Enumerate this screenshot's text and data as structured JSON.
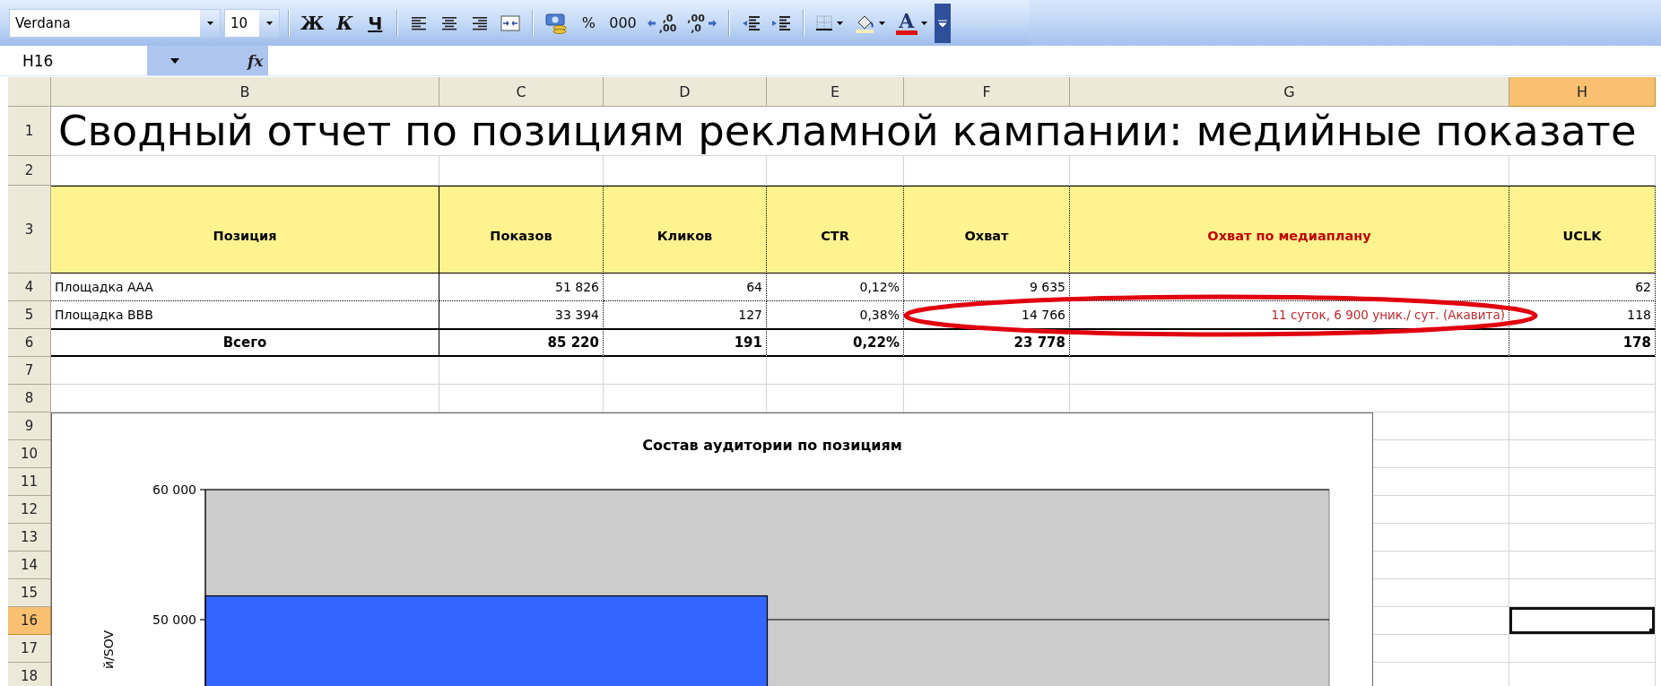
{
  "toolbar": {
    "font_name": "Verdana",
    "font_size": "10",
    "buttons": [
      {
        "kind": "bold",
        "label": "Ж"
      },
      {
        "kind": "italic",
        "label": "К"
      },
      {
        "kind": "underline",
        "label": "Ч"
      },
      {
        "kind": "separator"
      },
      {
        "kind": "align-left"
      },
      {
        "kind": "align-center"
      },
      {
        "kind": "align-right"
      },
      {
        "kind": "merge"
      },
      {
        "kind": "separator"
      },
      {
        "kind": "currency"
      },
      {
        "kind": "text",
        "label": "%"
      },
      {
        "kind": "text",
        "label": "000"
      },
      {
        "kind": "increase-decimal",
        "top": ",0",
        "bottom": ",00"
      },
      {
        "kind": "decrease-decimal",
        "top": ",00",
        "bottom": ",0"
      },
      {
        "kind": "separator"
      },
      {
        "kind": "outdent"
      },
      {
        "kind": "indent"
      },
      {
        "kind": "separator"
      },
      {
        "kind": "borders"
      },
      {
        "kind": "fill-color"
      },
      {
        "kind": "font-color",
        "label": "A"
      },
      {
        "kind": "options"
      }
    ]
  },
  "formula_bar": {
    "name_box": "H16",
    "function_label": "fx"
  },
  "sheet": {
    "columns": [
      {
        "label": "B",
        "selected": false
      },
      {
        "label": "C",
        "selected": false
      },
      {
        "label": "D",
        "selected": false
      },
      {
        "label": "E",
        "selected": false
      },
      {
        "label": "F",
        "selected": false
      },
      {
        "label": "G",
        "selected": false
      },
      {
        "label": "H",
        "selected": true
      }
    ],
    "rows": [
      {
        "label": "1",
        "selected": false
      },
      {
        "label": "2",
        "selected": false
      },
      {
        "label": "3",
        "selected": false
      },
      {
        "label": "4",
        "selected": false
      },
      {
        "label": "5",
        "selected": false
      },
      {
        "label": "6",
        "selected": false
      },
      {
        "label": "7",
        "selected": false
      },
      {
        "label": "8",
        "selected": false
      },
      {
        "label": "9",
        "selected": false
      },
      {
        "label": "10",
        "selected": false
      },
      {
        "label": "11",
        "selected": false
      },
      {
        "label": "12",
        "selected": false
      },
      {
        "label": "13",
        "selected": false
      },
      {
        "label": "14",
        "selected": false
      },
      {
        "label": "15",
        "selected": false
      },
      {
        "label": "16",
        "selected": true
      },
      {
        "label": "17",
        "selected": false
      },
      {
        "label": "18",
        "selected": false
      }
    ],
    "title": "Сводный отчет по позициям рекламной кампании: медийные показате",
    "table": {
      "columns": [
        {
          "label": "Позиция",
          "emphasized": false
        },
        {
          "label": "Показов",
          "emphasized": false
        },
        {
          "label": "Кликов",
          "emphasized": false
        },
        {
          "label": "CTR",
          "emphasized": false
        },
        {
          "label": "Охват",
          "emphasized": false
        },
        {
          "label": "Охват по медиаплану",
          "emphasized": true
        },
        {
          "label": "UCLK",
          "emphasized": false
        }
      ],
      "rows": [
        {
          "kind": "data",
          "position": "Площадка ААА",
          "impressions": "51 826",
          "clicks": "64",
          "ctr": "0,12%",
          "reach": "9 635",
          "uclk": "62"
        },
        {
          "kind": "data",
          "position": "Площадка ВВВ",
          "impressions": "33 394",
          "clicks": "127",
          "ctr": "0,38%",
          "reach": "14 766",
          "plan_reach": "11 суток, 6 900 уник./ сут. (Акавита)",
          "uclk": "118"
        },
        {
          "kind": "total",
          "position": "Всего",
          "impressions": "85 220",
          "clicks": "191",
          "ctr": "0,22%",
          "reach": "23 778",
          "uclk": "178"
        }
      ]
    },
    "chart": {
      "chart_data": {
        "type": "bar",
        "title": "Состав аудитории по позициям",
        "ylabel": "й/SOV",
        "values": [
          51826,
          null
        ],
        "ylim": [
          0,
          60000
        ],
        "yticks": [
          {
            "value": 50000,
            "label": "50 000"
          },
          {
            "value": 60000,
            "label": "60 000"
          }
        ]
      }
    }
  }
}
